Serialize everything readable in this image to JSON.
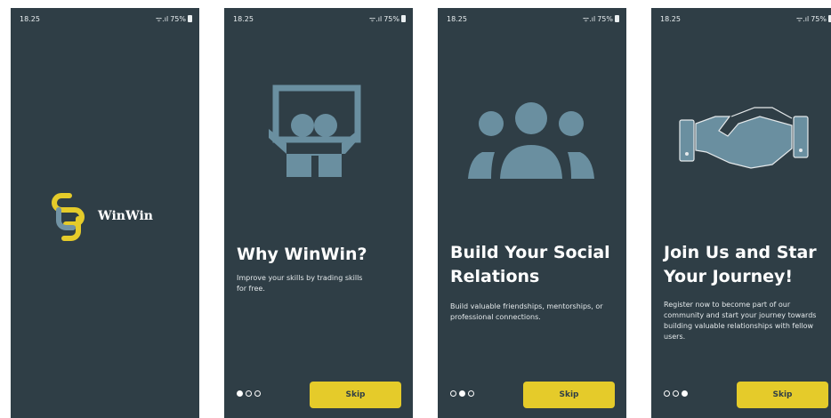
{
  "status_bar": {
    "time": "18.25",
    "indicators": "ᯤ.ıl",
    "battery": "75%"
  },
  "splash": {
    "brand_name": "WinWin",
    "logo_colors": {
      "yellow": "#e5cb2a",
      "blue": "#7193a4"
    }
  },
  "theme": {
    "background": "#2f3e46",
    "accent": "#e5cb2a",
    "illustration": "#5f8597"
  },
  "slides": [
    {
      "title": "Why WinWin?",
      "description": "Improve your skills by trading skills for free.",
      "icon": "presentation-people-icon",
      "page_index": 0
    },
    {
      "title": "Build Your Social Relations",
      "description": "Build valuable friendships, mentorships, or professional connections.",
      "icon": "group-of-people-icon",
      "page_index": 1
    },
    {
      "title": "Join Us and Star Your Journey!",
      "description": "Register now to become part of our community and start your journey towards building valuable relationships with fellow users.",
      "icon": "handshake-icon",
      "page_index": 2
    }
  ],
  "skip_label": "Skip"
}
